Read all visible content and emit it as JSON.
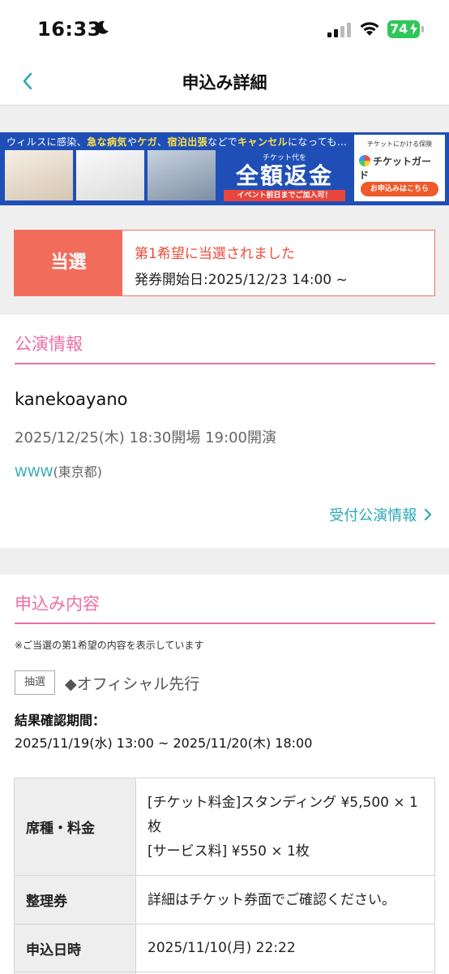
{
  "status_bar": {
    "time": "16:33",
    "battery": "74"
  },
  "nav": {
    "title": "申込み詳細"
  },
  "banner": {
    "top_plain_1": "ウィルスに感染、",
    "top_hl_1": "急な病気",
    "top_plain_2": "や",
    "top_hl_2": "ケガ",
    "top_plain_3": "、",
    "top_hl_3": "宿泊出張",
    "top_plain_4": "などで",
    "top_hl_4": "キャンセル",
    "top_plain_5": "になっても…",
    "mid_sub": "チケット代を",
    "mid_main": "全額返金",
    "mid_cta": "イベント前日までご加入可！",
    "right_small": "チケットにかける保険",
    "right_logo": "チケットガード",
    "right_btn": "お申込みはこちら"
  },
  "status": {
    "badge": "当選",
    "message": "第1希望に当選されました",
    "issue_date": "発券開始日:2025/12/23 14:00 ~"
  },
  "performance": {
    "heading": "公演情報",
    "artist": "kanekoayano",
    "datetime": "2025/12/25(木) 18:30開場 19:00開演",
    "venue_link": "WWW",
    "venue_area": "(東京都)",
    "reception_link": "受付公演情報"
  },
  "application": {
    "heading": "申込み内容",
    "note": "※ご当選の第1希望の内容を表示しています",
    "lottery_tag": "抽選",
    "sale_type": "◆オフィシャル先行",
    "period_label": "結果確認期間：",
    "period_value": "2025/11/19(水) 13:00 ~ 2025/11/20(木) 18:00",
    "table": {
      "seat_label": "席種・料金",
      "seat_line1": "[チケット料金]スタンディング ¥5,500 × 1枚",
      "seat_line2": "[サービス料] ¥550 × 1枚",
      "number_label": "整理券",
      "number_value": "詳細はチケット券面でご確認ください。",
      "date_label": "申込日時",
      "date_value": "2025/11/10(月) 22:22"
    }
  }
}
